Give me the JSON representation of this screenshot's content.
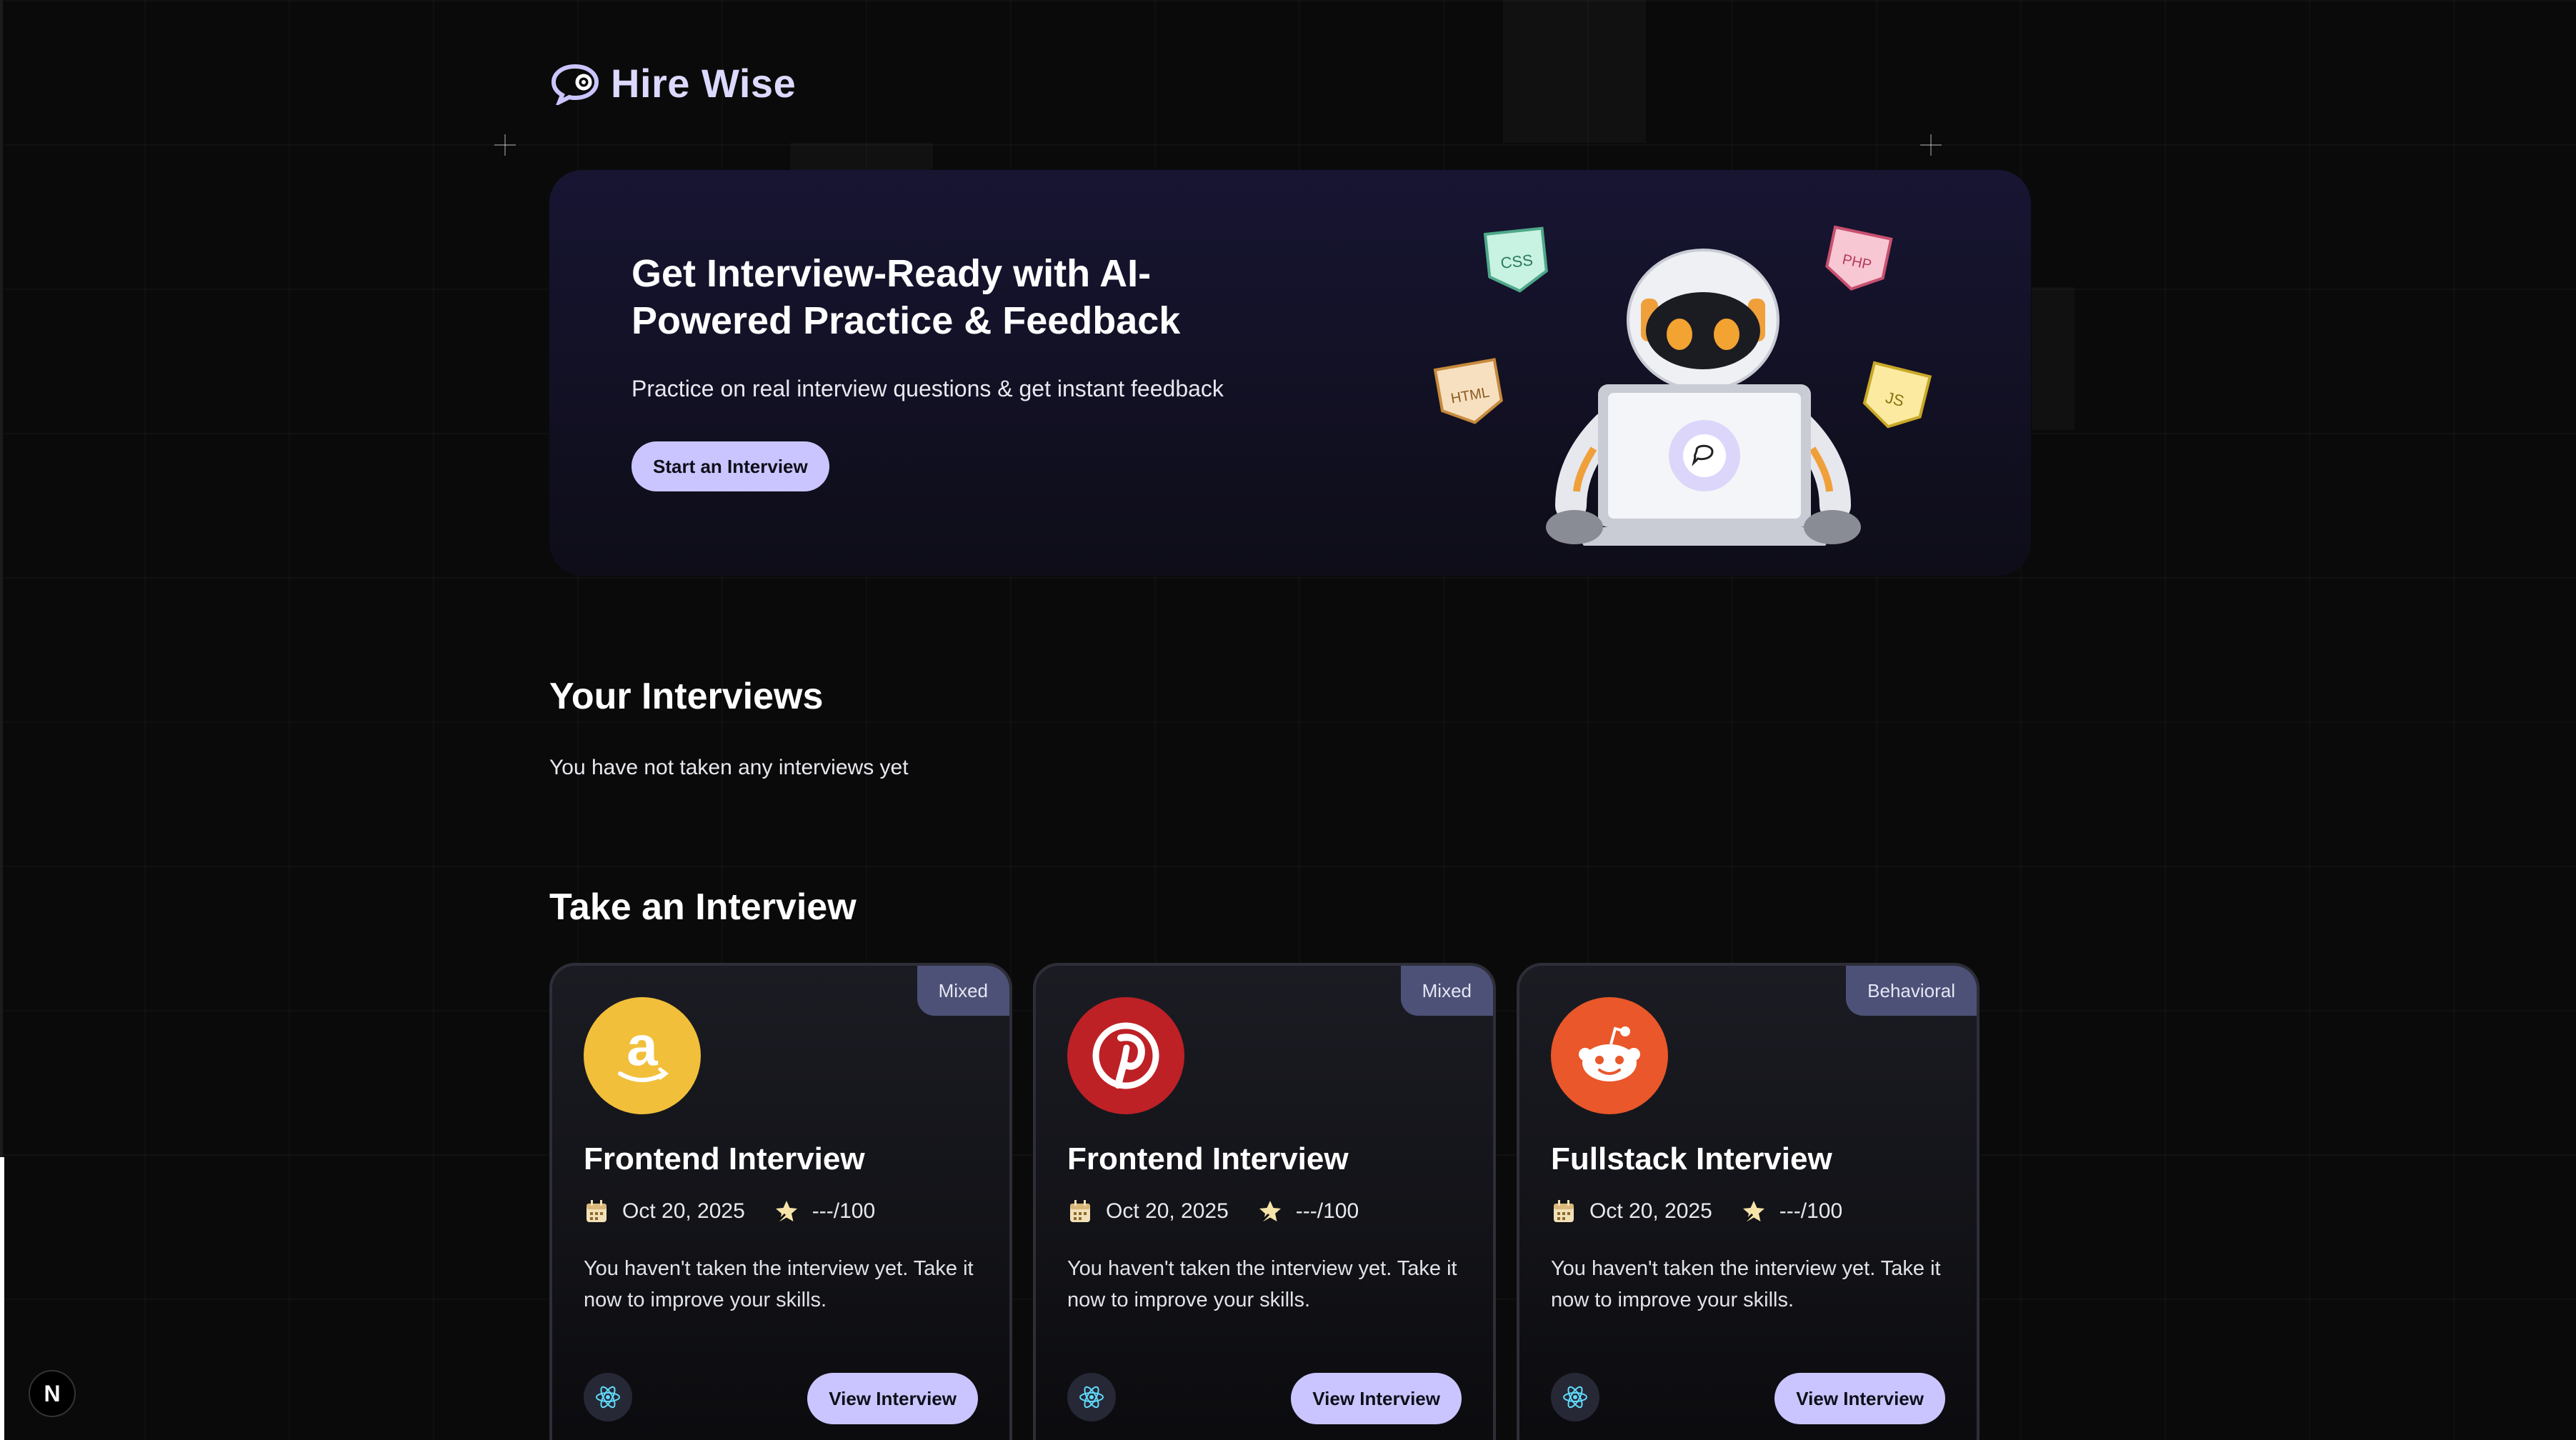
{
  "app": {
    "brand": "Hire Wise"
  },
  "hero": {
    "title": "Get Interview-Ready with AI-Powered Practice & Feedback",
    "subtitle": "Practice on real interview questions & get instant feedback",
    "button_label": "Start an Interview",
    "tags": [
      "CSS",
      "PHP",
      "HTML",
      "JS"
    ]
  },
  "your_interviews": {
    "title": "Your Interviews",
    "empty_message": "You have not taken any interviews yet"
  },
  "take_interview": {
    "title": "Take an Interview",
    "cards": [
      {
        "type": "Mixed",
        "company_icon": "amazon-logo",
        "logo_color": "#f1bf3a",
        "title": "Frontend Interview",
        "date": "Oct 20, 2025",
        "score": "---/100",
        "description": "You haven't taken the interview yet. Take it now to improve your skills.",
        "tech_icon": "react-icon",
        "button_label": "View Interview"
      },
      {
        "type": "Mixed",
        "company_icon": "pinterest-logo",
        "logo_color": "#bd2126",
        "title": "Frontend Interview",
        "date": "Oct 20, 2025",
        "score": "---/100",
        "description": "You haven't taken the interview yet. Take it now to improve your skills.",
        "tech_icon": "react-icon",
        "button_label": "View Interview"
      },
      {
        "type": "Behavioral",
        "company_icon": "reddit-logo",
        "logo_color": "#e9572a",
        "title": "Fullstack Interview",
        "date": "Oct 20, 2025",
        "score": "---/100",
        "description": "You haven't taken the interview yet. Take it now to improve your skills.",
        "tech_icon": "react-icon",
        "button_label": "View Interview"
      }
    ]
  },
  "dev_badge": "N",
  "colors": {
    "accent": "#cac5fe",
    "badge_bg": "#4d5177",
    "background": "#0a0a0a"
  }
}
